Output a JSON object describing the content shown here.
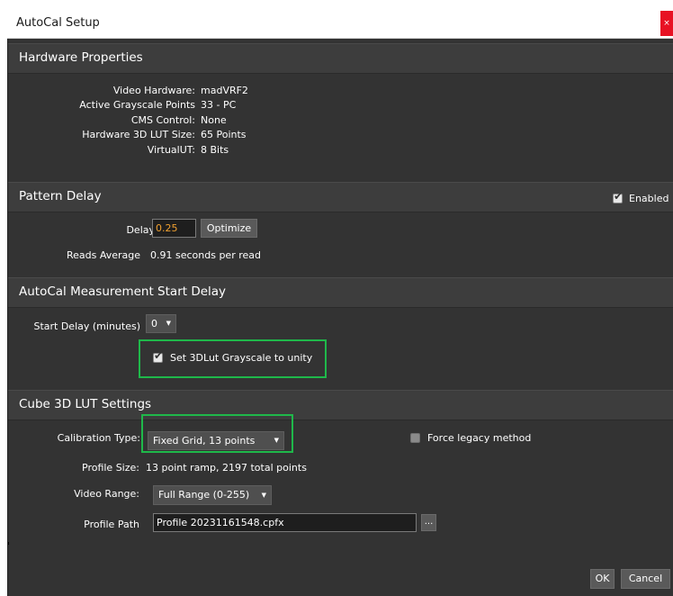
{
  "window": {
    "title": "AutoCal Setup",
    "close_glyph": "×"
  },
  "hardware": {
    "section_title": "Hardware Properties",
    "rows": [
      {
        "label": "Video Hardware:",
        "value": "madVRF2"
      },
      {
        "label": "Active Grayscale Points",
        "value": "33 - PC"
      },
      {
        "label": "CMS Control:",
        "value": "None"
      },
      {
        "label": "Hardware 3D LUT Size:",
        "value": "65 Points"
      },
      {
        "label": "VirtualUT:",
        "value": "8 Bits"
      }
    ]
  },
  "pattern_delay": {
    "section_title": "Pattern Delay",
    "enabled_label": "Enabled",
    "enabled": true,
    "delay_label": "Delay",
    "delay_value": "0.25",
    "optimize_label": "Optimize",
    "reads_label": "Reads Average",
    "reads_value": "0.91 seconds per read"
  },
  "start_delay": {
    "section_title": "AutoCal Measurement Start Delay",
    "label": "Start Delay (minutes)",
    "value": "0",
    "unity_label": "Set 3DLut Grayscale to unity",
    "unity_checked": true
  },
  "cube": {
    "section_title": "Cube 3D LUT Settings",
    "calibration_type_label": "Calibration Type:",
    "calibration_type_value": "Fixed Grid, 13 points",
    "force_legacy_label": "Force legacy method",
    "force_legacy_checked": false,
    "profile_size_label": "Profile Size:",
    "profile_size_value": "13  point ramp,  2197  total points",
    "video_range_label": "Video Range:",
    "video_range_value": "Full Range (0-255)",
    "profile_path_label": "Profile Path",
    "profile_path_value": "Profile 20231161548.cpfx",
    "browse_label": "..."
  },
  "footer": {
    "ok_label": "OK",
    "cancel_label": "Cancel"
  },
  "colors": {
    "dialog_bg": "#333333",
    "section_header_bg": "#3d3d3d",
    "highlight_green": "#1fb84a",
    "delay_text_orange": "#f0a030",
    "close_red": "#e81123"
  }
}
